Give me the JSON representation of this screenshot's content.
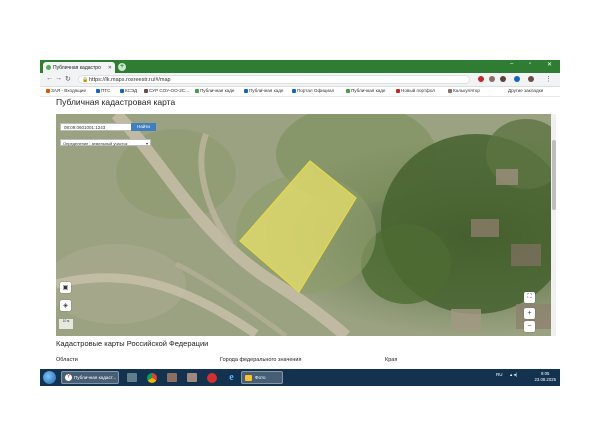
{
  "browser": {
    "tab_title": "Публичная кадастро",
    "tab_close": "✕",
    "new_tab": "+",
    "window_controls": [
      "–",
      "▫",
      "✕"
    ],
    "url": "https://lk.maps.rosreestr.ru/#/map",
    "nav": {
      "back": "←",
      "forward": "→",
      "reload": "↻"
    },
    "bookmarks": [
      {
        "label": "ЗАЯ - Входящие",
        "color": "#e65100"
      },
      {
        "label": "ПТС",
        "color": "#1565c0"
      },
      {
        "label": "КСЭД",
        "color": "#1565c0"
      },
      {
        "label": "СУР СОУ-ОО-2С...",
        "color": "#6d4c41"
      },
      {
        "label": "Публичная каде",
        "color": "#43a047"
      },
      {
        "label": "Публичная каде",
        "color": "#1565c0"
      },
      {
        "label": "Портал Официал",
        "color": "#1565c0"
      },
      {
        "label": "Публичная каде",
        "color": "#43a047"
      },
      {
        "label": "Новый портфол",
        "color": "#c62828"
      },
      {
        "label": "Калькулятор",
        "color": "#8d6e63"
      }
    ],
    "other_bookmarks": "Другие закладки"
  },
  "page": {
    "title": "Публичная кадастровая карта"
  },
  "map": {
    "search_value": "08:09:0601001:1243",
    "search_button": "Найти",
    "filter_label": "Определение : земельный участок",
    "scale_label": "10 м",
    "parcel_color": "#f2e86b"
  },
  "below": {
    "section_title": "Кадастровые карты Российской Федерации",
    "columns": [
      "Области",
      "Города федерального значения",
      "Края"
    ]
  },
  "taskbar": {
    "active_window": "Публичная кадаст...",
    "folder_window": "Фото",
    "lang": "RU",
    "time": "9:05",
    "date": "23.08.2025"
  }
}
